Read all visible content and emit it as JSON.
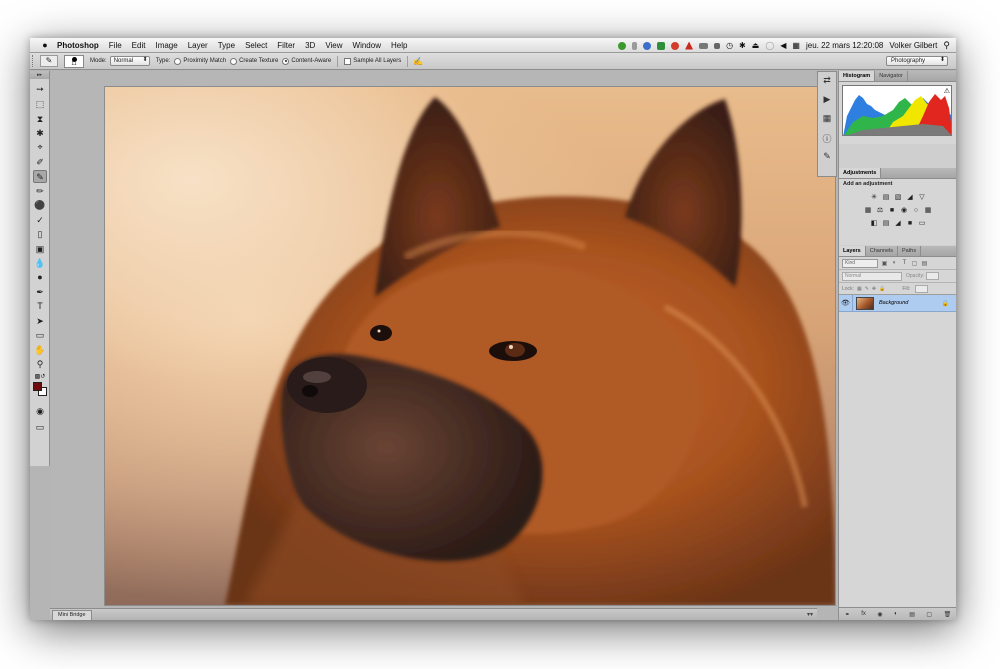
{
  "menubar": {
    "apple": "",
    "app_name": "Photoshop",
    "items": [
      "File",
      "Edit",
      "Image",
      "Layer",
      "Type",
      "Select",
      "Filter",
      "3D",
      "View",
      "Window",
      "Help"
    ],
    "datetime": "jeu. 22 mars  12:20:08",
    "user": "Volker Gilbert"
  },
  "options": {
    "brush_size": "11",
    "mode_label": "Mode:",
    "mode_value": "Normal",
    "type_label": "Type:",
    "proximity_match": "Proximity Match",
    "create_texture": "Create Texture",
    "content_aware": "Content-Aware",
    "sample_all_layers": "Sample All Layers",
    "workspace": "Photography"
  },
  "panels": {
    "top_tabs": [
      "Histogram",
      "Navigator"
    ],
    "adjustments_tab": "Adjustments",
    "adjustments_title": "Add an adjustment",
    "layers_tabs": [
      "Layers",
      "Channels",
      "Paths"
    ],
    "kind_label": "Kind",
    "blend_mode": "Normal",
    "opacity_label": "Opacity:",
    "lock_label": "Lock:",
    "fill_label": "Fill:",
    "layer_name": "Background"
  },
  "mini_bridge": {
    "tab_label": "Mini Bridge"
  },
  "colors": {
    "foreground": "#6e0b0e",
    "background": "#ffffff",
    "layer_selected": "#aecbf0"
  }
}
